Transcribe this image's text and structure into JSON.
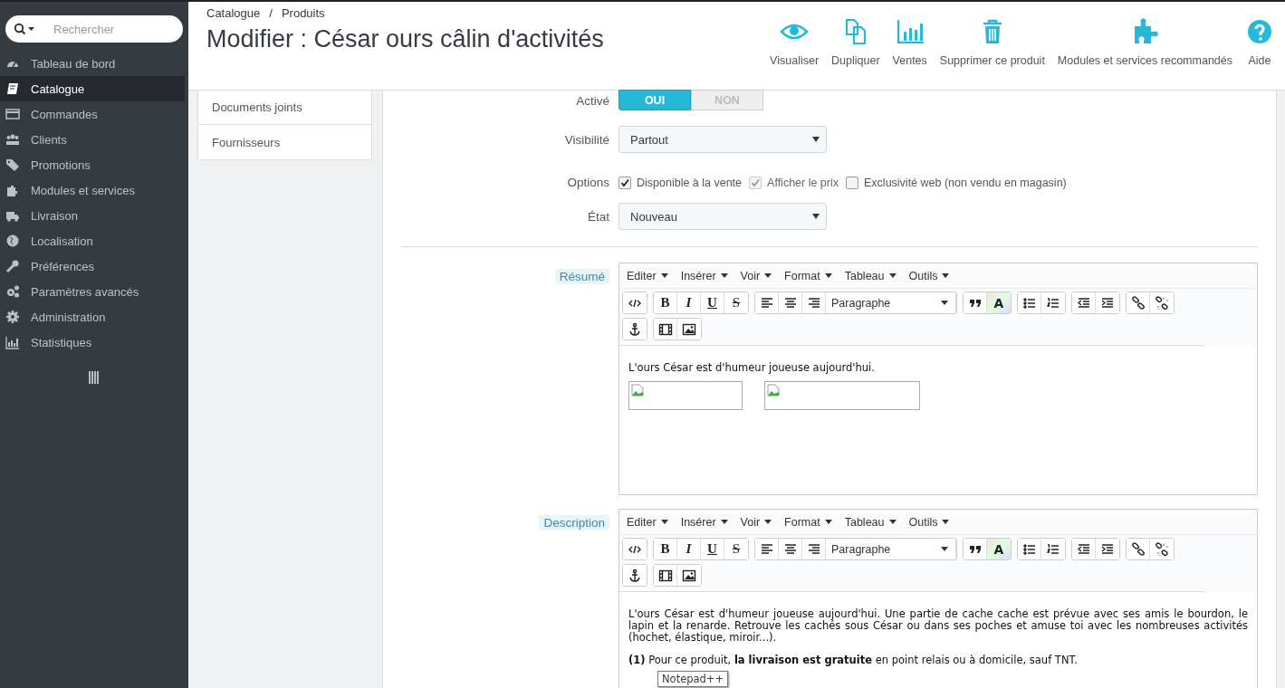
{
  "sidebar": {
    "search": {
      "placeholder": "Rechercher"
    },
    "items": [
      {
        "label": "Tableau de bord",
        "selected": false
      },
      {
        "label": "Catalogue",
        "selected": true
      },
      {
        "label": "Commandes",
        "selected": false
      },
      {
        "label": "Clients",
        "selected": false
      },
      {
        "label": "Promotions",
        "selected": false
      },
      {
        "label": "Modules et services",
        "selected": false
      },
      {
        "label": "Livraison",
        "selected": false
      },
      {
        "label": "Localisation",
        "selected": false
      },
      {
        "label": "Préférences",
        "selected": false
      },
      {
        "label": "Paramètres avancés",
        "selected": false
      },
      {
        "label": "Administration",
        "selected": false
      },
      {
        "label": "Statistiques",
        "selected": false
      }
    ]
  },
  "header": {
    "breadcrumb": [
      "Catalogue",
      "/",
      "Produits"
    ],
    "title": "Modifier : César ours câlin d'activités",
    "actions": [
      {
        "label": "Visualiser"
      },
      {
        "label": "Dupliquer"
      },
      {
        "label": "Ventes"
      },
      {
        "label": "Supprimer ce produit"
      },
      {
        "label": "Modules et services recommandés"
      },
      {
        "label": "Aide"
      }
    ]
  },
  "product_tabs": [
    {
      "label": "Documents joints"
    },
    {
      "label": "Fournisseurs"
    }
  ],
  "form": {
    "active": {
      "label": "Activé",
      "options": [
        {
          "label": "OUI",
          "selected": true
        },
        {
          "label": "NON",
          "selected": false
        }
      ]
    },
    "visibility": {
      "label": "Visibilité",
      "value": "Partout"
    },
    "options": {
      "label": "Options",
      "items": [
        {
          "label": "Disponible à la vente",
          "checked": true,
          "disabled": false
        },
        {
          "label": "Afficher le prix",
          "checked": true,
          "disabled": true
        },
        {
          "label": "Exclusivité web (non vendu en magasin)",
          "checked": false,
          "disabled": false
        }
      ]
    },
    "condition": {
      "label": "État",
      "value": "Nouveau"
    },
    "editors": [
      {
        "label": "Résumé",
        "menus": [
          "Editer",
          "Insérer",
          "Voir",
          "Format",
          "Tableau",
          "Outils"
        ],
        "format_buttons": [
          "B",
          "I",
          "U",
          "S"
        ],
        "block_format": "Paragraphe",
        "text_color_label": "A",
        "content": [
          {
            "kind": "paragraph",
            "text": "L'ours César est d'humeur joueuse aujourd'hui."
          },
          {
            "kind": "image"
          },
          {
            "kind": "image"
          }
        ]
      },
      {
        "label": "Description",
        "menus": [
          "Editer",
          "Insérer",
          "Voir",
          "Format",
          "Tableau",
          "Outils"
        ],
        "format_buttons": [
          "B",
          "I",
          "U",
          "S"
        ],
        "block_format": "Paragraphe",
        "text_color_label": "A",
        "content": [
          {
            "kind": "paragraph",
            "text": "L'ours César est d'humeur joueuse aujourd'hui. Une partie de cache cache est prévue avec ses amis le bourdon, le lapin et la renarde. Retrouve les cachés sous César ou dans ses poches et amuse toi avec les nombreuses activités (hochet, élastique, miroir...)."
          },
          {
            "kind": "paragraph",
            "text": "**(1)** Pour ce produit, **la livraison est gratuite** en point relais ou à domicile, sauf TNT."
          }
        ]
      }
    ]
  },
  "tooltip": "Notepad++"
}
